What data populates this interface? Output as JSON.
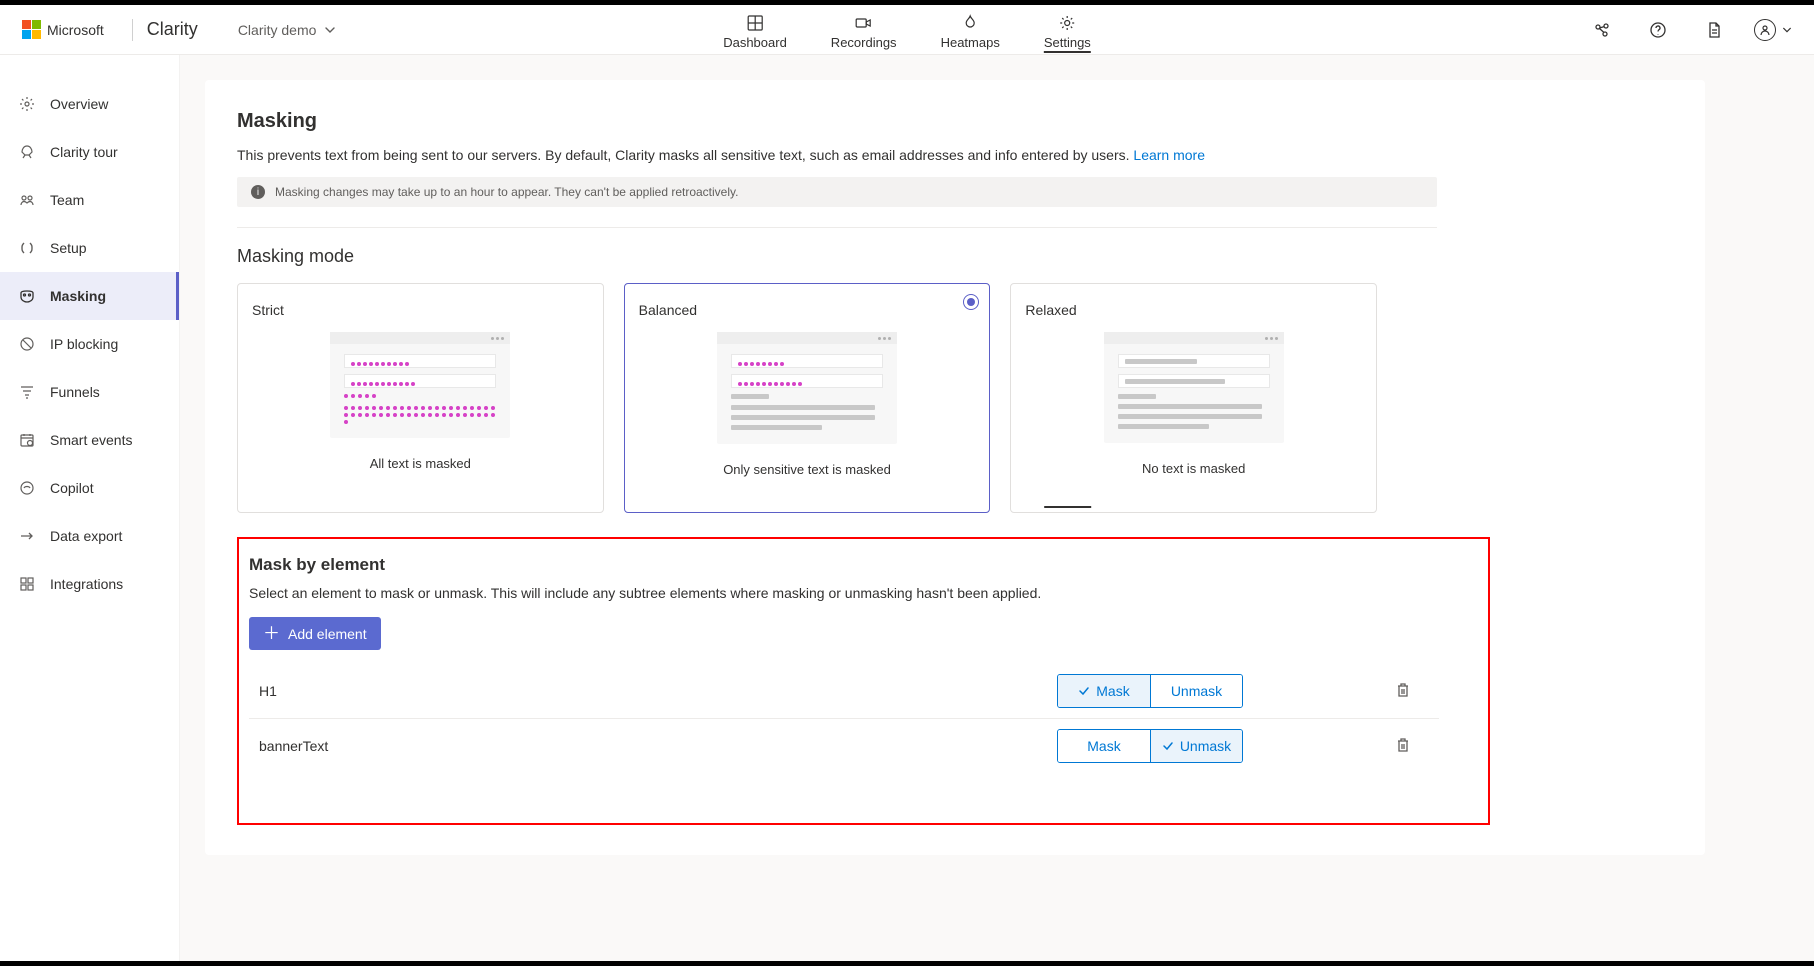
{
  "header": {
    "company": "Microsoft",
    "product": "Clarity",
    "project": "Clarity demo",
    "nav": [
      {
        "label": "Dashboard",
        "key": "dashboard"
      },
      {
        "label": "Recordings",
        "key": "recordings"
      },
      {
        "label": "Heatmaps",
        "key": "heatmaps"
      },
      {
        "label": "Settings",
        "key": "settings"
      }
    ],
    "active_nav": "settings"
  },
  "sidebar": {
    "items": [
      {
        "label": "Overview",
        "key": "overview"
      },
      {
        "label": "Clarity tour",
        "key": "clarity-tour"
      },
      {
        "label": "Team",
        "key": "team"
      },
      {
        "label": "Setup",
        "key": "setup"
      },
      {
        "label": "Masking",
        "key": "masking"
      },
      {
        "label": "IP blocking",
        "key": "ip-blocking"
      },
      {
        "label": "Funnels",
        "key": "funnels"
      },
      {
        "label": "Smart events",
        "key": "smart-events"
      },
      {
        "label": "Copilot",
        "key": "copilot"
      },
      {
        "label": "Data export",
        "key": "data-export"
      },
      {
        "label": "Integrations",
        "key": "integrations"
      }
    ],
    "active": "masking"
  },
  "page": {
    "title": "Masking",
    "description": "This prevents text from being sent to our servers. By default, Clarity masks all sensitive text, such as email addresses and info entered by users.",
    "learn_more": "Learn more",
    "info_notice": "Masking changes may take up to an hour to appear. They can't be applied retroactively.",
    "masking_mode_title": "Masking mode",
    "modes": [
      {
        "name": "Strict",
        "desc": "All text is masked",
        "key": "strict"
      },
      {
        "name": "Balanced",
        "desc": "Only sensitive text is masked",
        "key": "balanced"
      },
      {
        "name": "Relaxed",
        "desc": "No text is masked",
        "key": "relaxed"
      }
    ],
    "selected_mode": "balanced",
    "mask_by_element": {
      "title": "Mask by element",
      "description": "Select an element to mask or unmask. This will include any subtree elements where masking or unmasking hasn't been applied.",
      "add_button": "Add element",
      "mask_label": "Mask",
      "unmask_label": "Unmask",
      "rows": [
        {
          "selector": "H1",
          "mode": "mask"
        },
        {
          "selector": "bannerText",
          "mode": "unmask"
        }
      ]
    }
  }
}
